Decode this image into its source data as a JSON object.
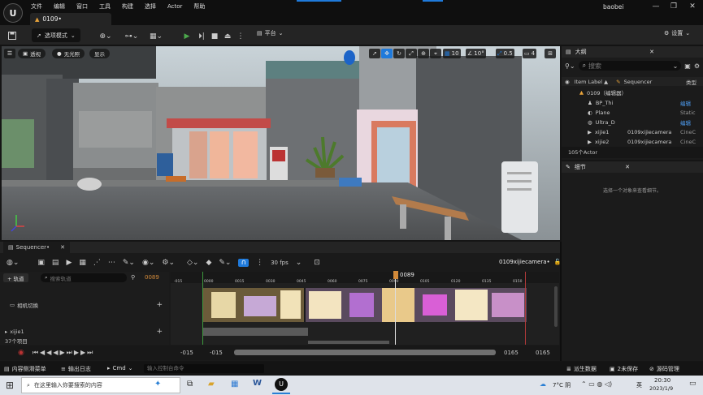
{
  "titlebar": {
    "menu": [
      "文件",
      "编辑",
      "窗口",
      "工具",
      "构建",
      "选择",
      "Actor",
      "帮助"
    ],
    "doc_tab": "0109•",
    "user": "baobei",
    "win_min": "—",
    "win_max": "❐",
    "win_close": "✕"
  },
  "toolbar": {
    "mode": "选项模式",
    "platform": "平台",
    "settings": "设置"
  },
  "viewport": {
    "perspective": "透视",
    "lighting": "无光照",
    "show": "显示",
    "grid_size": "10",
    "angle": "10°",
    "scale": "0.5",
    "camera_speed": "4"
  },
  "outliner": {
    "tab": "大纲",
    "search_placeholder": "搜索",
    "col_label": "Item Label ▲",
    "col_sequencer": "Sequencer",
    "col_type": "类型",
    "root": "0109（编辑器）",
    "rows": [
      {
        "label": "BP_Thi",
        "seq": "",
        "type": "编辑"
      },
      {
        "label": "Plane",
        "seq": "",
        "type": "Static"
      },
      {
        "label": "Ultra_D",
        "seq": "",
        "type": "编辑"
      },
      {
        "label": "xijie1",
        "seq": "0109xijiecamera",
        "type": "CineC"
      },
      {
        "label": "xijie2",
        "seq": "0109xijiecamera",
        "type": "CineC"
      }
    ],
    "count": "105个Actor"
  },
  "details": {
    "tab": "细节",
    "empty": "选择一个对象来查看细节。"
  },
  "sequencer": {
    "tab": "Sequencer•",
    "fps": "30 fps",
    "sequence_name": "0109xijiecamera•",
    "add_track": "+ 轨道",
    "search_placeholder": "搜索轨道",
    "current_frame": "0089",
    "playhead_label": "0089",
    "track_camera_cut": "相机切换",
    "track_xijie": "xijie1",
    "item_count": "37个项目",
    "ruler_ticks": [
      "-015",
      "0000",
      "0015",
      "0030",
      "0045",
      "0060",
      "0075",
      "0090",
      "0105",
      "0120",
      "0135",
      "0150"
    ],
    "range_start_left": "-015",
    "range_start_right": "-015",
    "range_end_left": "0165",
    "range_end_right": "0165"
  },
  "statusbar": {
    "content_drawer": "内容侧滑菜单",
    "output_log": "输出日志",
    "cmd": "Cmd",
    "cmd_placeholder": "输入控制台命令",
    "derived_data": "派生数据",
    "unsaved": "2未保存",
    "source_control": "源码管理"
  },
  "taskbar": {
    "search_placeholder": "在这里输入你要搜索的内容",
    "weather": "7°C 阴",
    "ime": "英",
    "time": "20:30",
    "date": "2023/1/9"
  },
  "colors": {
    "accent_blue": "#1f7adb",
    "play_green": "#4ca84c",
    "playhead_orange": "#d28a3a"
  }
}
